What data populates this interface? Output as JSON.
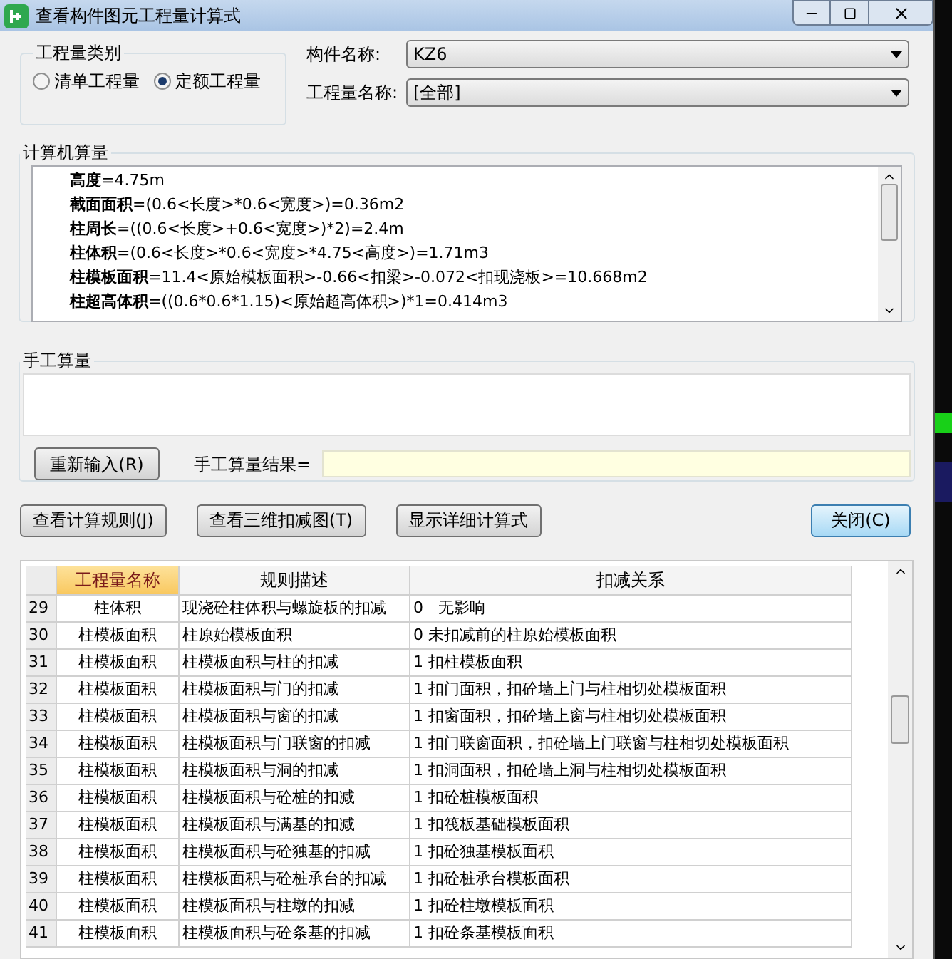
{
  "window": {
    "title": "查看构件图元工程量计算式"
  },
  "quantity_type": {
    "title": "工程量类别",
    "options": [
      {
        "label": "清单工程量",
        "selected": false
      },
      {
        "label": "定额工程量",
        "selected": true
      }
    ]
  },
  "component_name": {
    "label": "构件名称:",
    "value": "KZ6"
  },
  "quantity_name": {
    "label": "工程量名称:",
    "value": "[全部]"
  },
  "computer_calc": {
    "title": "计算机算量",
    "lines": [
      "**高度**=4.75m",
      "**截面面积**=(0.6<长度>*0.6<宽度>)=0.36m2",
      "**柱周长**=((0.6<长度>+0.6<宽度>)*2)=2.4m",
      "**柱体积**=(0.6<长度>*0.6<宽度>*4.75<高度>)=1.71m3",
      "**柱模板面积**=11.4<原始模板面积>-0.66<扣梁>-0.072<扣现浇板>=10.668m2",
      "**柱超高体积**=((0.6*0.6*1.15)<原始超高体积>)*1=0.414m3"
    ]
  },
  "manual_calc": {
    "title": "手工算量",
    "reenter_button": "重新输入(R)",
    "result_label": "手工算量结果="
  },
  "buttons": [
    {
      "label": "查看计算规则(J)",
      "kind": "normal"
    },
    {
      "label": "查看三维扣减图(T)",
      "kind": "normal"
    },
    {
      "label": "显示详细计算式",
      "kind": "normal"
    },
    {
      "label": "关闭(C)",
      "kind": "default"
    }
  ],
  "table": {
    "columns": [
      {
        "selected": false
      },
      {
        "label": "工程量名称",
        "selected": true
      },
      {
        "label": "规则描述",
        "selected": false
      },
      {
        "label": "扣减关系",
        "selected": false
      }
    ],
    "rows": [
      [
        "29",
        "柱体积",
        "现浇砼柱体积与螺旋板的扣减",
        "0   无影响"
      ],
      [
        "30",
        "柱模板面积",
        "柱原始模板面积",
        "0 未扣减前的柱原始模板面积"
      ],
      [
        "31",
        "柱模板面积",
        "柱模板面积与柱的扣减",
        "1 扣柱模板面积"
      ],
      [
        "32",
        "柱模板面积",
        "柱模板面积与门的扣减",
        "1 扣门面积，扣砼墙上门与柱相切处模板面积"
      ],
      [
        "33",
        "柱模板面积",
        "柱模板面积与窗的扣减",
        "1 扣窗面积，扣砼墙上窗与柱相切处模板面积"
      ],
      [
        "34",
        "柱模板面积",
        "柱模板面积与门联窗的扣减",
        "1 扣门联窗面积，扣砼墙上门联窗与柱相切处模板面积"
      ],
      [
        "35",
        "柱模板面积",
        "柱模板面积与洞的扣减",
        "1 扣洞面积，扣砼墙上洞与柱相切处模板面积"
      ],
      [
        "36",
        "柱模板面积",
        "柱模板面积与砼桩的扣减",
        "1 扣砼桩模板面积"
      ],
      [
        "37",
        "柱模板面积",
        "柱模板面积与满基的扣减",
        "1 扣筏板基础模板面积"
      ],
      [
        "38",
        "柱模板面积",
        "柱模板面积与砼独基的扣减",
        "1 扣砼独基模板面积"
      ],
      [
        "39",
        "柱模板面积",
        "柱模板面积与砼桩承台的扣减",
        "1 扣砼桩承台模板面积"
      ],
      [
        "40",
        "柱模板面积",
        "柱模板面积与柱墩的扣减",
        "1 扣砼柱墩模板面积"
      ],
      [
        "41",
        "柱模板面积",
        "柱模板面积与砼条基的扣减",
        "1 扣砼条基模板面积"
      ]
    ]
  }
}
